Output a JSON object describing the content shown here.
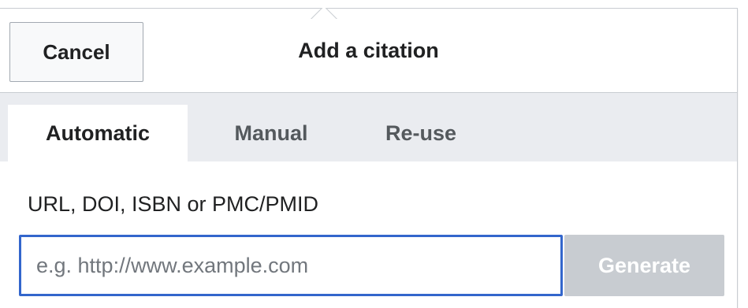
{
  "dialog": {
    "title": "Add a citation",
    "cancel_label": "Cancel"
  },
  "tabs": [
    {
      "label": "Automatic",
      "active": true
    },
    {
      "label": "Manual",
      "active": false
    },
    {
      "label": "Re-use",
      "active": false
    }
  ],
  "lookup": {
    "label": "URL, DOI, ISBN or PMC/PMID",
    "value": "",
    "placeholder": "e.g. http://www.example.com",
    "generate_label": "Generate",
    "generate_enabled": false
  },
  "colors": {
    "accent": "#3366cc",
    "tab_bar": "#eaecf0",
    "disabled_button": "#c8ccd1"
  }
}
